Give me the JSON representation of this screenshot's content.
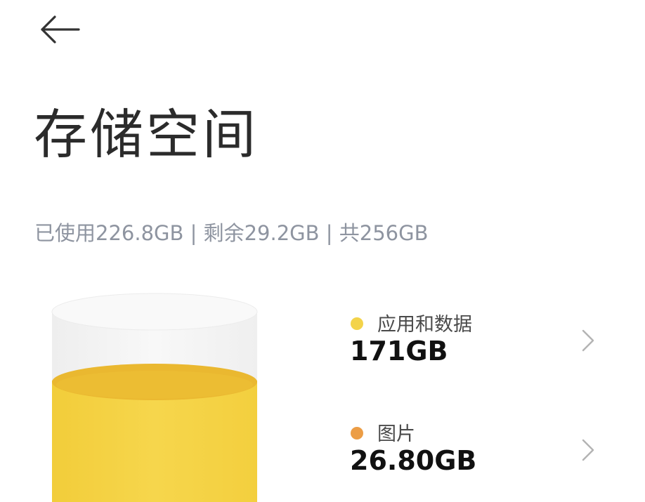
{
  "header": {
    "back_icon": "arrow-left-icon",
    "title": "存储空间"
  },
  "summary": {
    "used": "已使用226.8GB",
    "remaining": "剩余29.2GB",
    "total": "共256GB",
    "separator": "|"
  },
  "usage_chart": {
    "used_gb": 226.8,
    "total_gb": 256,
    "fill_color": "#f5d03f",
    "empty_color": "#f4f4f4"
  },
  "categories": [
    {
      "label": "应用和数据",
      "size": "171GB",
      "color": "#f3d34a",
      "chevron_icon": "chevron-right-icon"
    },
    {
      "label": "图片",
      "size": "26.80GB",
      "color": "#ec9d45",
      "chevron_icon": "chevron-right-icon"
    }
  ]
}
